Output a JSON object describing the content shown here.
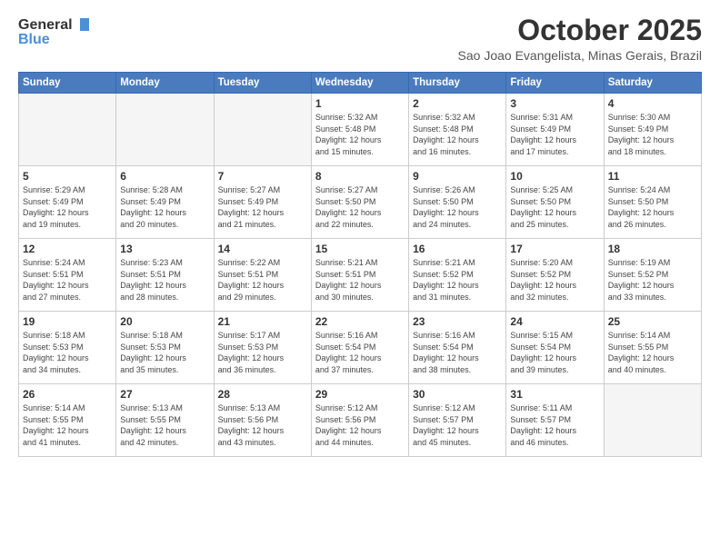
{
  "logo": {
    "line1": "General",
    "line2": "Blue"
  },
  "title": "October 2025",
  "location": "Sao Joao Evangelista, Minas Gerais, Brazil",
  "days_header": [
    "Sunday",
    "Monday",
    "Tuesday",
    "Wednesday",
    "Thursday",
    "Friday",
    "Saturday"
  ],
  "weeks": [
    [
      {
        "day": "",
        "info": ""
      },
      {
        "day": "",
        "info": ""
      },
      {
        "day": "",
        "info": ""
      },
      {
        "day": "1",
        "info": "Sunrise: 5:32 AM\nSunset: 5:48 PM\nDaylight: 12 hours\nand 15 minutes."
      },
      {
        "day": "2",
        "info": "Sunrise: 5:32 AM\nSunset: 5:48 PM\nDaylight: 12 hours\nand 16 minutes."
      },
      {
        "day": "3",
        "info": "Sunrise: 5:31 AM\nSunset: 5:49 PM\nDaylight: 12 hours\nand 17 minutes."
      },
      {
        "day": "4",
        "info": "Sunrise: 5:30 AM\nSunset: 5:49 PM\nDaylight: 12 hours\nand 18 minutes."
      }
    ],
    [
      {
        "day": "5",
        "info": "Sunrise: 5:29 AM\nSunset: 5:49 PM\nDaylight: 12 hours\nand 19 minutes."
      },
      {
        "day": "6",
        "info": "Sunrise: 5:28 AM\nSunset: 5:49 PM\nDaylight: 12 hours\nand 20 minutes."
      },
      {
        "day": "7",
        "info": "Sunrise: 5:27 AM\nSunset: 5:49 PM\nDaylight: 12 hours\nand 21 minutes."
      },
      {
        "day": "8",
        "info": "Sunrise: 5:27 AM\nSunset: 5:50 PM\nDaylight: 12 hours\nand 22 minutes."
      },
      {
        "day": "9",
        "info": "Sunrise: 5:26 AM\nSunset: 5:50 PM\nDaylight: 12 hours\nand 24 minutes."
      },
      {
        "day": "10",
        "info": "Sunrise: 5:25 AM\nSunset: 5:50 PM\nDaylight: 12 hours\nand 25 minutes."
      },
      {
        "day": "11",
        "info": "Sunrise: 5:24 AM\nSunset: 5:50 PM\nDaylight: 12 hours\nand 26 minutes."
      }
    ],
    [
      {
        "day": "12",
        "info": "Sunrise: 5:24 AM\nSunset: 5:51 PM\nDaylight: 12 hours\nand 27 minutes."
      },
      {
        "day": "13",
        "info": "Sunrise: 5:23 AM\nSunset: 5:51 PM\nDaylight: 12 hours\nand 28 minutes."
      },
      {
        "day": "14",
        "info": "Sunrise: 5:22 AM\nSunset: 5:51 PM\nDaylight: 12 hours\nand 29 minutes."
      },
      {
        "day": "15",
        "info": "Sunrise: 5:21 AM\nSunset: 5:51 PM\nDaylight: 12 hours\nand 30 minutes."
      },
      {
        "day": "16",
        "info": "Sunrise: 5:21 AM\nSunset: 5:52 PM\nDaylight: 12 hours\nand 31 minutes."
      },
      {
        "day": "17",
        "info": "Sunrise: 5:20 AM\nSunset: 5:52 PM\nDaylight: 12 hours\nand 32 minutes."
      },
      {
        "day": "18",
        "info": "Sunrise: 5:19 AM\nSunset: 5:52 PM\nDaylight: 12 hours\nand 33 minutes."
      }
    ],
    [
      {
        "day": "19",
        "info": "Sunrise: 5:18 AM\nSunset: 5:53 PM\nDaylight: 12 hours\nand 34 minutes."
      },
      {
        "day": "20",
        "info": "Sunrise: 5:18 AM\nSunset: 5:53 PM\nDaylight: 12 hours\nand 35 minutes."
      },
      {
        "day": "21",
        "info": "Sunrise: 5:17 AM\nSunset: 5:53 PM\nDaylight: 12 hours\nand 36 minutes."
      },
      {
        "day": "22",
        "info": "Sunrise: 5:16 AM\nSunset: 5:54 PM\nDaylight: 12 hours\nand 37 minutes."
      },
      {
        "day": "23",
        "info": "Sunrise: 5:16 AM\nSunset: 5:54 PM\nDaylight: 12 hours\nand 38 minutes."
      },
      {
        "day": "24",
        "info": "Sunrise: 5:15 AM\nSunset: 5:54 PM\nDaylight: 12 hours\nand 39 minutes."
      },
      {
        "day": "25",
        "info": "Sunrise: 5:14 AM\nSunset: 5:55 PM\nDaylight: 12 hours\nand 40 minutes."
      }
    ],
    [
      {
        "day": "26",
        "info": "Sunrise: 5:14 AM\nSunset: 5:55 PM\nDaylight: 12 hours\nand 41 minutes."
      },
      {
        "day": "27",
        "info": "Sunrise: 5:13 AM\nSunset: 5:55 PM\nDaylight: 12 hours\nand 42 minutes."
      },
      {
        "day": "28",
        "info": "Sunrise: 5:13 AM\nSunset: 5:56 PM\nDaylight: 12 hours\nand 43 minutes."
      },
      {
        "day": "29",
        "info": "Sunrise: 5:12 AM\nSunset: 5:56 PM\nDaylight: 12 hours\nand 44 minutes."
      },
      {
        "day": "30",
        "info": "Sunrise: 5:12 AM\nSunset: 5:57 PM\nDaylight: 12 hours\nand 45 minutes."
      },
      {
        "day": "31",
        "info": "Sunrise: 5:11 AM\nSunset: 5:57 PM\nDaylight: 12 hours\nand 46 minutes."
      },
      {
        "day": "",
        "info": ""
      }
    ]
  ]
}
